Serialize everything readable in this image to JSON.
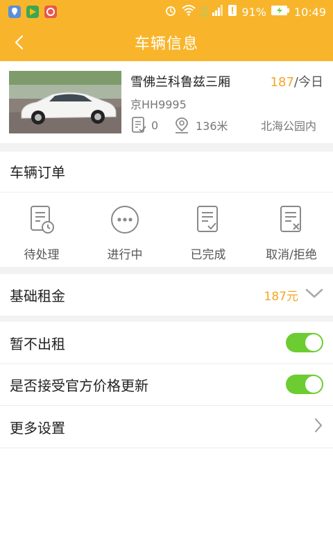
{
  "status_bar": {
    "battery_percent": "91%",
    "time": "10:49",
    "network_top": "3G",
    "network_bottom": "4G"
  },
  "header": {
    "title": "车辆信息"
  },
  "car": {
    "name": "雪佛兰科鲁兹三厢",
    "price_value": "187",
    "price_unit": "/今日",
    "plate": "京HH9995",
    "order_count": "0",
    "distance": "136米",
    "location": "北海公园内"
  },
  "orders": {
    "title": "车辆订单",
    "items": [
      {
        "label": "待处理",
        "icon": "clipboard-clock-icon"
      },
      {
        "label": "进行中",
        "icon": "ellipsis-circle-icon"
      },
      {
        "label": "已完成",
        "icon": "clipboard-check-icon"
      },
      {
        "label": "取消/拒绝",
        "icon": "clipboard-x-icon"
      }
    ]
  },
  "rent": {
    "label": "基础租金",
    "value": "187元"
  },
  "settings": {
    "no_rent_label": "暂不出租",
    "no_rent_on": true,
    "accept_price_label": "是否接受官方价格更新",
    "accept_price_on": true,
    "more_label": "更多设置"
  },
  "colors": {
    "brand": "#f8b52b",
    "accent": "#f5a623",
    "toggle_on": "#6dcc31"
  }
}
